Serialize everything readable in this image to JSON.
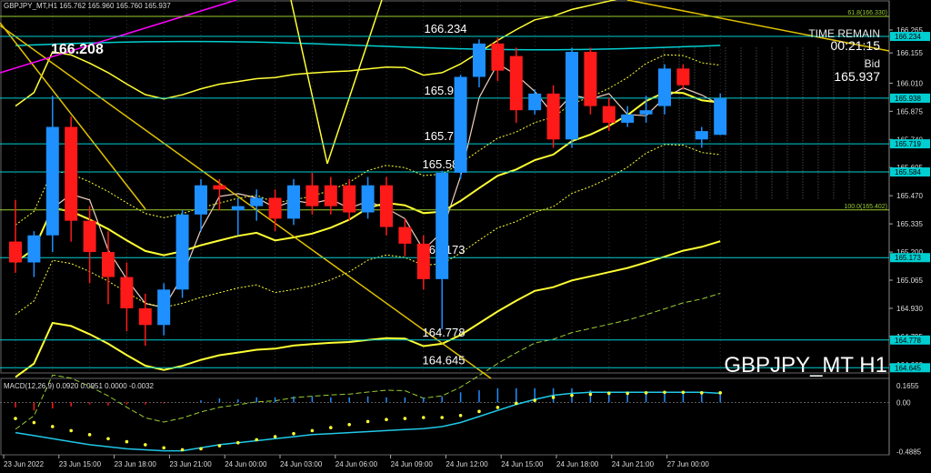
{
  "header": {
    "info": "GBPJPY_MT,H1  165.762 165.960 165.760 165.937"
  },
  "overlay": {
    "time_remain_label": "TIME REMAIN",
    "time_remain_value": "00:21:15",
    "bid_label": "Bid",
    "bid_value": "165.937",
    "big_price": "166.208",
    "symbol_label": "GBPJPY_MT H1"
  },
  "levels": [
    {
      "label": "166.234",
      "price": 166.234
    },
    {
      "label": "165.938",
      "price": 165.938
    },
    {
      "label": "165.719",
      "price": 165.719
    },
    {
      "label": "165.584",
      "price": 165.584
    },
    {
      "label": "165.173",
      "price": 165.173
    },
    {
      "label": "164.778",
      "price": 164.778
    },
    {
      "label": "164.645",
      "price": 164.645
    }
  ],
  "fibo": [
    {
      "label": "61.8(166.330)",
      "price": 166.33
    },
    {
      "label": "100.0(165.402)",
      "price": 165.402
    }
  ],
  "price_axis": {
    "ticks": [
      "166.265",
      "166.155",
      "166.010",
      "165.875",
      "165.740",
      "165.605",
      "165.470",
      "165.335",
      "165.200",
      "165.065",
      "164.930",
      "164.795",
      "164.660"
    ],
    "tick_values": [
      166.265,
      166.155,
      166.01,
      165.875,
      165.74,
      165.605,
      165.47,
      165.335,
      165.2,
      165.065,
      164.93,
      164.795,
      164.66
    ],
    "tags": [
      {
        "label": "166.234",
        "price": 166.234
      },
      {
        "label": "165.938",
        "price": 165.938
      },
      {
        "label": "165.719",
        "price": 165.719
      },
      {
        "label": "165.584",
        "price": 165.584
      },
      {
        "label": "165.173",
        "price": 165.173
      },
      {
        "label": "164.778",
        "price": 164.778
      },
      {
        "label": "164.645",
        "price": 164.645
      }
    ]
  },
  "macd": {
    "label": "MACD(12,26,9) 0.0920 0.0951 0.0000 -0.0032",
    "ticks": [
      "0.1655",
      "0.00",
      "-0.4885"
    ]
  },
  "time_axis": {
    "labels": [
      "23 Jun 2022",
      "23 Jun 15:00",
      "23 Jun 18:00",
      "23 Jun 21:00",
      "24 Jun 00:00",
      "24 Jun 03:00",
      "24 Jun 06:00",
      "24 Jun 09:00",
      "24 Jun 12:00",
      "24 Jun 15:00",
      "24 Jun 18:00",
      "24 Jun 21:00",
      "27 Jun 00:00"
    ]
  },
  "colors": {
    "bull": "#1e90ff",
    "bear": "#ff1a1a",
    "level": "#00ced1",
    "fibo": "#9acd32",
    "ma": "#ffff33",
    "trend": "#e0c000",
    "magenta": "#ff00ff"
  },
  "chart_data": {
    "type": "candlestick",
    "candles": [
      {
        "o": 165.25,
        "h": 165.45,
        "l": 165.1,
        "c": 165.15
      },
      {
        "o": 165.15,
        "h": 165.3,
        "l": 165.08,
        "c": 165.28
      },
      {
        "o": 165.28,
        "h": 165.95,
        "l": 165.2,
        "c": 165.8
      },
      {
        "o": 165.8,
        "h": 165.85,
        "l": 165.25,
        "c": 165.35
      },
      {
        "o": 165.35,
        "h": 165.42,
        "l": 165.05,
        "c": 165.2
      },
      {
        "o": 165.2,
        "h": 165.3,
        "l": 164.95,
        "c": 165.08
      },
      {
        "o": 165.08,
        "h": 165.15,
        "l": 164.82,
        "c": 164.93
      },
      {
        "o": 164.93,
        "h": 165.0,
        "l": 164.75,
        "c": 164.85
      },
      {
        "o": 164.85,
        "h": 165.05,
        "l": 164.8,
        "c": 165.02
      },
      {
        "o": 165.02,
        "h": 165.4,
        "l": 164.98,
        "c": 165.38
      },
      {
        "o": 165.38,
        "h": 165.55,
        "l": 165.3,
        "c": 165.52
      },
      {
        "o": 165.52,
        "h": 165.55,
        "l": 165.4,
        "c": 165.5
      },
      {
        "o": 165.4,
        "h": 165.46,
        "l": 165.28,
        "c": 165.42
      },
      {
        "o": 165.42,
        "h": 165.5,
        "l": 165.35,
        "c": 165.46
      },
      {
        "o": 165.46,
        "h": 165.5,
        "l": 165.3,
        "c": 165.36
      },
      {
        "o": 165.36,
        "h": 165.55,
        "l": 165.33,
        "c": 165.52
      },
      {
        "o": 165.52,
        "h": 165.58,
        "l": 165.38,
        "c": 165.42
      },
      {
        "o": 165.52,
        "h": 165.56,
        "l": 165.38,
        "c": 165.42
      },
      {
        "o": 165.52,
        "h": 165.55,
        "l": 165.35,
        "c": 165.39
      },
      {
        "o": 165.39,
        "h": 165.56,
        "l": 165.36,
        "c": 165.52
      },
      {
        "o": 165.52,
        "h": 165.56,
        "l": 165.28,
        "c": 165.32
      },
      {
        "o": 165.32,
        "h": 165.36,
        "l": 165.18,
        "c": 165.24
      },
      {
        "o": 165.24,
        "h": 165.28,
        "l": 165.02,
        "c": 165.07
      },
      {
        "o": 165.07,
        "h": 165.59,
        "l": 164.83,
        "c": 165.58
      },
      {
        "o": 165.58,
        "h": 166.05,
        "l": 165.55,
        "c": 166.04
      },
      {
        "o": 166.04,
        "h": 166.22,
        "l": 165.99,
        "c": 166.2
      },
      {
        "o": 166.2,
        "h": 166.23,
        "l": 166.02,
        "c": 166.07
      },
      {
        "o": 166.14,
        "h": 166.18,
        "l": 165.82,
        "c": 165.88
      },
      {
        "o": 165.88,
        "h": 165.98,
        "l": 165.86,
        "c": 165.96
      },
      {
        "o": 165.96,
        "h": 166.0,
        "l": 165.7,
        "c": 165.74
      },
      {
        "o": 165.74,
        "h": 166.18,
        "l": 165.7,
        "c": 166.16
      },
      {
        "o": 166.16,
        "h": 166.18,
        "l": 165.86,
        "c": 165.9
      },
      {
        "o": 165.9,
        "h": 165.94,
        "l": 165.78,
        "c": 165.82
      },
      {
        "o": 165.82,
        "h": 165.9,
        "l": 165.8,
        "c": 165.86
      },
      {
        "o": 165.86,
        "h": 165.95,
        "l": 165.82,
        "c": 165.88
      },
      {
        "o": 165.9,
        "h": 166.1,
        "l": 165.86,
        "c": 166.08
      },
      {
        "o": 166.08,
        "h": 166.1,
        "l": 165.98,
        "c": 166.0
      },
      {
        "o": 165.74,
        "h": 165.8,
        "l": 165.7,
        "c": 165.78
      },
      {
        "o": 165.762,
        "h": 165.96,
        "l": 165.76,
        "c": 165.937
      }
    ],
    "macd_hist": [
      -0.05,
      -0.08,
      -0.06,
      -0.04,
      -0.02,
      -0.03,
      -0.02,
      -0.02,
      -0.01,
      0.0,
      0.02,
      0.04,
      0.03,
      0.05,
      0.05,
      0.06,
      0.06,
      0.05,
      0.05,
      0.06,
      0.05,
      0.05,
      0.05,
      0.06,
      0.1,
      0.12,
      0.14,
      0.14,
      0.14,
      0.14,
      0.14,
      0.12,
      0.11,
      0.11,
      0.1,
      0.1,
      0.11,
      0.1,
      0.09
    ],
    "macd_signal": [
      -0.16,
      -0.2,
      -0.24,
      -0.28,
      -0.32,
      -0.36,
      -0.39,
      -0.42,
      -0.45,
      -0.47,
      -0.46,
      -0.43,
      -0.4,
      -0.37,
      -0.34,
      -0.31,
      -0.28,
      -0.25,
      -0.22,
      -0.19,
      -0.17,
      -0.16,
      -0.15,
      -0.15,
      -0.13,
      -0.09,
      -0.05,
      -0.01,
      0.02,
      0.05,
      0.07,
      0.08,
      0.09,
      0.09,
      0.095,
      0.1,
      0.1,
      0.095,
      0.095
    ],
    "macd_line": [
      -0.3,
      -0.33,
      -0.36,
      -0.39,
      -0.42,
      -0.44,
      -0.46,
      -0.47,
      -0.48,
      -0.48,
      -0.45,
      -0.42,
      -0.4,
      -0.38,
      -0.36,
      -0.34,
      -0.32,
      -0.31,
      -0.3,
      -0.29,
      -0.28,
      -0.27,
      -0.26,
      -0.24,
      -0.2,
      -0.14,
      -0.08,
      -0.02,
      0.03,
      0.07,
      0.09,
      0.1,
      0.1,
      0.1,
      0.1,
      0.1,
      0.1,
      0.1,
      0.09
    ]
  }
}
